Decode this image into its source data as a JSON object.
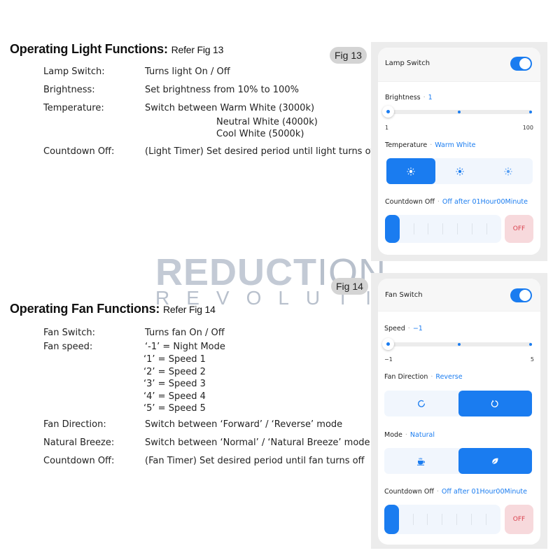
{
  "light_section": {
    "heading": "Operating Light Functions:",
    "ref": "Refer Fig 13",
    "rows": [
      {
        "label": "Lamp Switch:",
        "value": "Turns light On / Off"
      },
      {
        "label": "Brightness:",
        "value": "Set brightness from 10% to 100%"
      },
      {
        "label": "Temperature:",
        "value": "Switch between Warm White (3000k)"
      },
      {
        "label": "Countdown Off:",
        "value": "(Light Timer) Set desired period until light turns off"
      }
    ],
    "temperature_extra": [
      "Neutral White (4000k)",
      "Cool White (5000k)"
    ]
  },
  "fan_section": {
    "heading": "Operating Fan Functions:",
    "ref": "Refer Fig 14",
    "rows": [
      {
        "label": "Fan Switch:",
        "value": "Turns fan On / Off"
      },
      {
        "label": "Fan speed:",
        "value": "‘-1’ = Night Mode"
      },
      {
        "label": "Fan Direction:",
        "value": "Switch between ‘Forward’ / ‘Reverse’ mode"
      },
      {
        "label": "Natural Breeze:",
        "value": "Switch between ‘Normal’ / ‘Natural Breeze’ mode"
      },
      {
        "label": "Countdown Off:",
        "value": "(Fan Timer) Set desired period until fan turns off"
      }
    ],
    "speed_extra": [
      "‘1’  = Speed 1",
      "‘2’  = Speed 2",
      "‘3’  = Speed 3",
      "‘4’  = Speed 4",
      "‘5’  = Speed 5"
    ]
  },
  "watermark": {
    "line1_bold": "REDUCT",
    "line1_thin": "ION",
    "line2": "REVOLUTION"
  },
  "fig13": {
    "badge": "Fig 13",
    "lamp_switch": {
      "label": "Lamp Switch",
      "on": true
    },
    "brightness": {
      "label": "Brightness",
      "value": "1",
      "min": "1",
      "max": "100",
      "fraction": 0
    },
    "temperature": {
      "label": "Temperature",
      "value": "Warm White",
      "options": [
        "warm-white",
        "neutral-white",
        "cool-white"
      ],
      "selected": 0
    },
    "countdown": {
      "label": "Countdown Off",
      "value": "Off after 01Hour00Minute",
      "off_label": "OFF"
    }
  },
  "fig14": {
    "badge": "Fig 14",
    "fan_switch": {
      "label": "Fan Switch",
      "on": true
    },
    "speed": {
      "label": "Speed",
      "value": "−1",
      "min": "−1",
      "max": "5",
      "fraction": 0
    },
    "direction": {
      "label": "Fan Direction",
      "value": "Reverse",
      "options": [
        "forward",
        "reverse"
      ],
      "selected": 1
    },
    "mode": {
      "label": "Mode",
      "value": "Natural",
      "options": [
        "normal",
        "natural"
      ],
      "selected": 1
    },
    "countdown": {
      "label": "Countdown Off",
      "value": "Off after 01Hour00Minute",
      "off_label": "OFF"
    }
  },
  "colors": {
    "accent": "#1a7cf0",
    "off_bg": "#f7d9dc",
    "off_text": "#d9434f",
    "badge_bg": "#d4d4d4"
  }
}
